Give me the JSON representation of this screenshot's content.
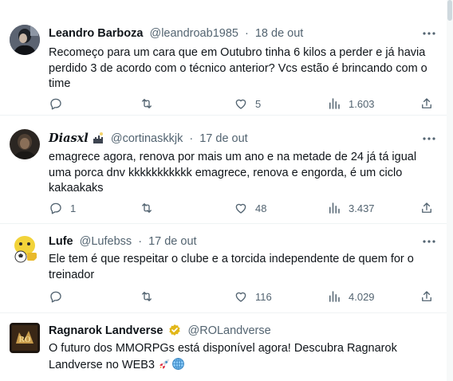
{
  "tweets": [
    {
      "name": "Leandro Barboza",
      "handle": "@leandroab1985",
      "date": "18 de out",
      "text": "Recomeço para um cara que em Outubro tinha 6 kilos a perder e já havia perdido 3 de acordo com o técnico anterior? Vcs estão é brincando com o time",
      "replies": "",
      "retweets": "",
      "likes": "5",
      "views": "1.603"
    },
    {
      "name": "Diasxl",
      "handle": "@cortinaskkjk",
      "date": "17 de out",
      "text": "emagrece agora, renova por mais um ano e na metade de 24 já tá igual uma porca dnv kkkkkkkkkkk emagrece, renova e engorda, é um ciclo kakaakaks",
      "replies": "1",
      "retweets": "",
      "likes": "48",
      "views": "3.437"
    },
    {
      "name": "Lufe",
      "handle": "@Lufebss",
      "date": "17 de out",
      "text": "Ele tem é que respeitar o clube e a torcida independente de quem for o treinador",
      "replies": "",
      "retweets": "",
      "likes": "116",
      "views": "4.029"
    },
    {
      "name": "Ragnarok Landverse",
      "handle": "@ROLandverse",
      "date": "",
      "text": "O futuro dos MMORPGs está disponível agora! Descubra Ragnarok Landverse no WEB3",
      "verified": "gold-verified-badge",
      "emojis": [
        "rocket-emoji",
        "globe-emoji"
      ]
    }
  ],
  "icons": {
    "reply": "reply-icon",
    "retweet": "retweet-icon",
    "like": "like-icon",
    "views": "views-icon",
    "share": "share-icon",
    "more": "more-icon"
  },
  "colors": {
    "text": "#0f1419",
    "muted": "#536471",
    "divider": "#eff3f4",
    "verified": "#e2b719"
  }
}
